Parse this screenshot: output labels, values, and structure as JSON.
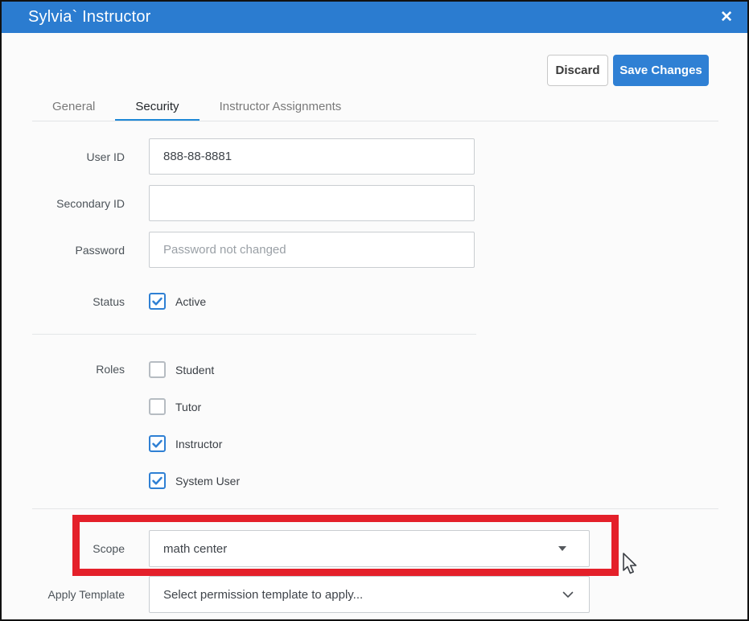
{
  "window": {
    "title": "Sylvia` Instructor",
    "close_glyph": "✕"
  },
  "actions": {
    "discard_label": "Discard",
    "save_label": "Save Changes"
  },
  "tabs": [
    {
      "label": "General",
      "active": false
    },
    {
      "label": "Security",
      "active": true
    },
    {
      "label": "Instructor Assignments",
      "active": false
    }
  ],
  "form": {
    "user_id": {
      "label": "User ID",
      "value": "888-88-8881"
    },
    "secondary_id": {
      "label": "Secondary ID",
      "value": ""
    },
    "password": {
      "label": "Password",
      "placeholder": "Password not changed"
    },
    "status": {
      "label": "Status",
      "option": "Active",
      "checked": true
    },
    "roles": {
      "label": "Roles",
      "options": [
        {
          "label": "Student",
          "checked": false
        },
        {
          "label": "Tutor",
          "checked": false
        },
        {
          "label": "Instructor",
          "checked": true
        },
        {
          "label": "System User",
          "checked": true
        }
      ]
    },
    "scope": {
      "label": "Scope",
      "value": "math center"
    },
    "apply_template": {
      "label": "Apply Template",
      "value": "Select permission template to apply..."
    }
  },
  "colors": {
    "header_blue": "#2b7cd0",
    "primary_blue": "#2f80d4",
    "tab_underline_blue": "#1e88d6",
    "highlight_red": "#e4202a",
    "checkbox_checked_border": "#2f80d4"
  },
  "annotations": {
    "scope_highlight": "red rectangle around Scope row",
    "pointer": "arrow cursor right of Scope highlight"
  }
}
